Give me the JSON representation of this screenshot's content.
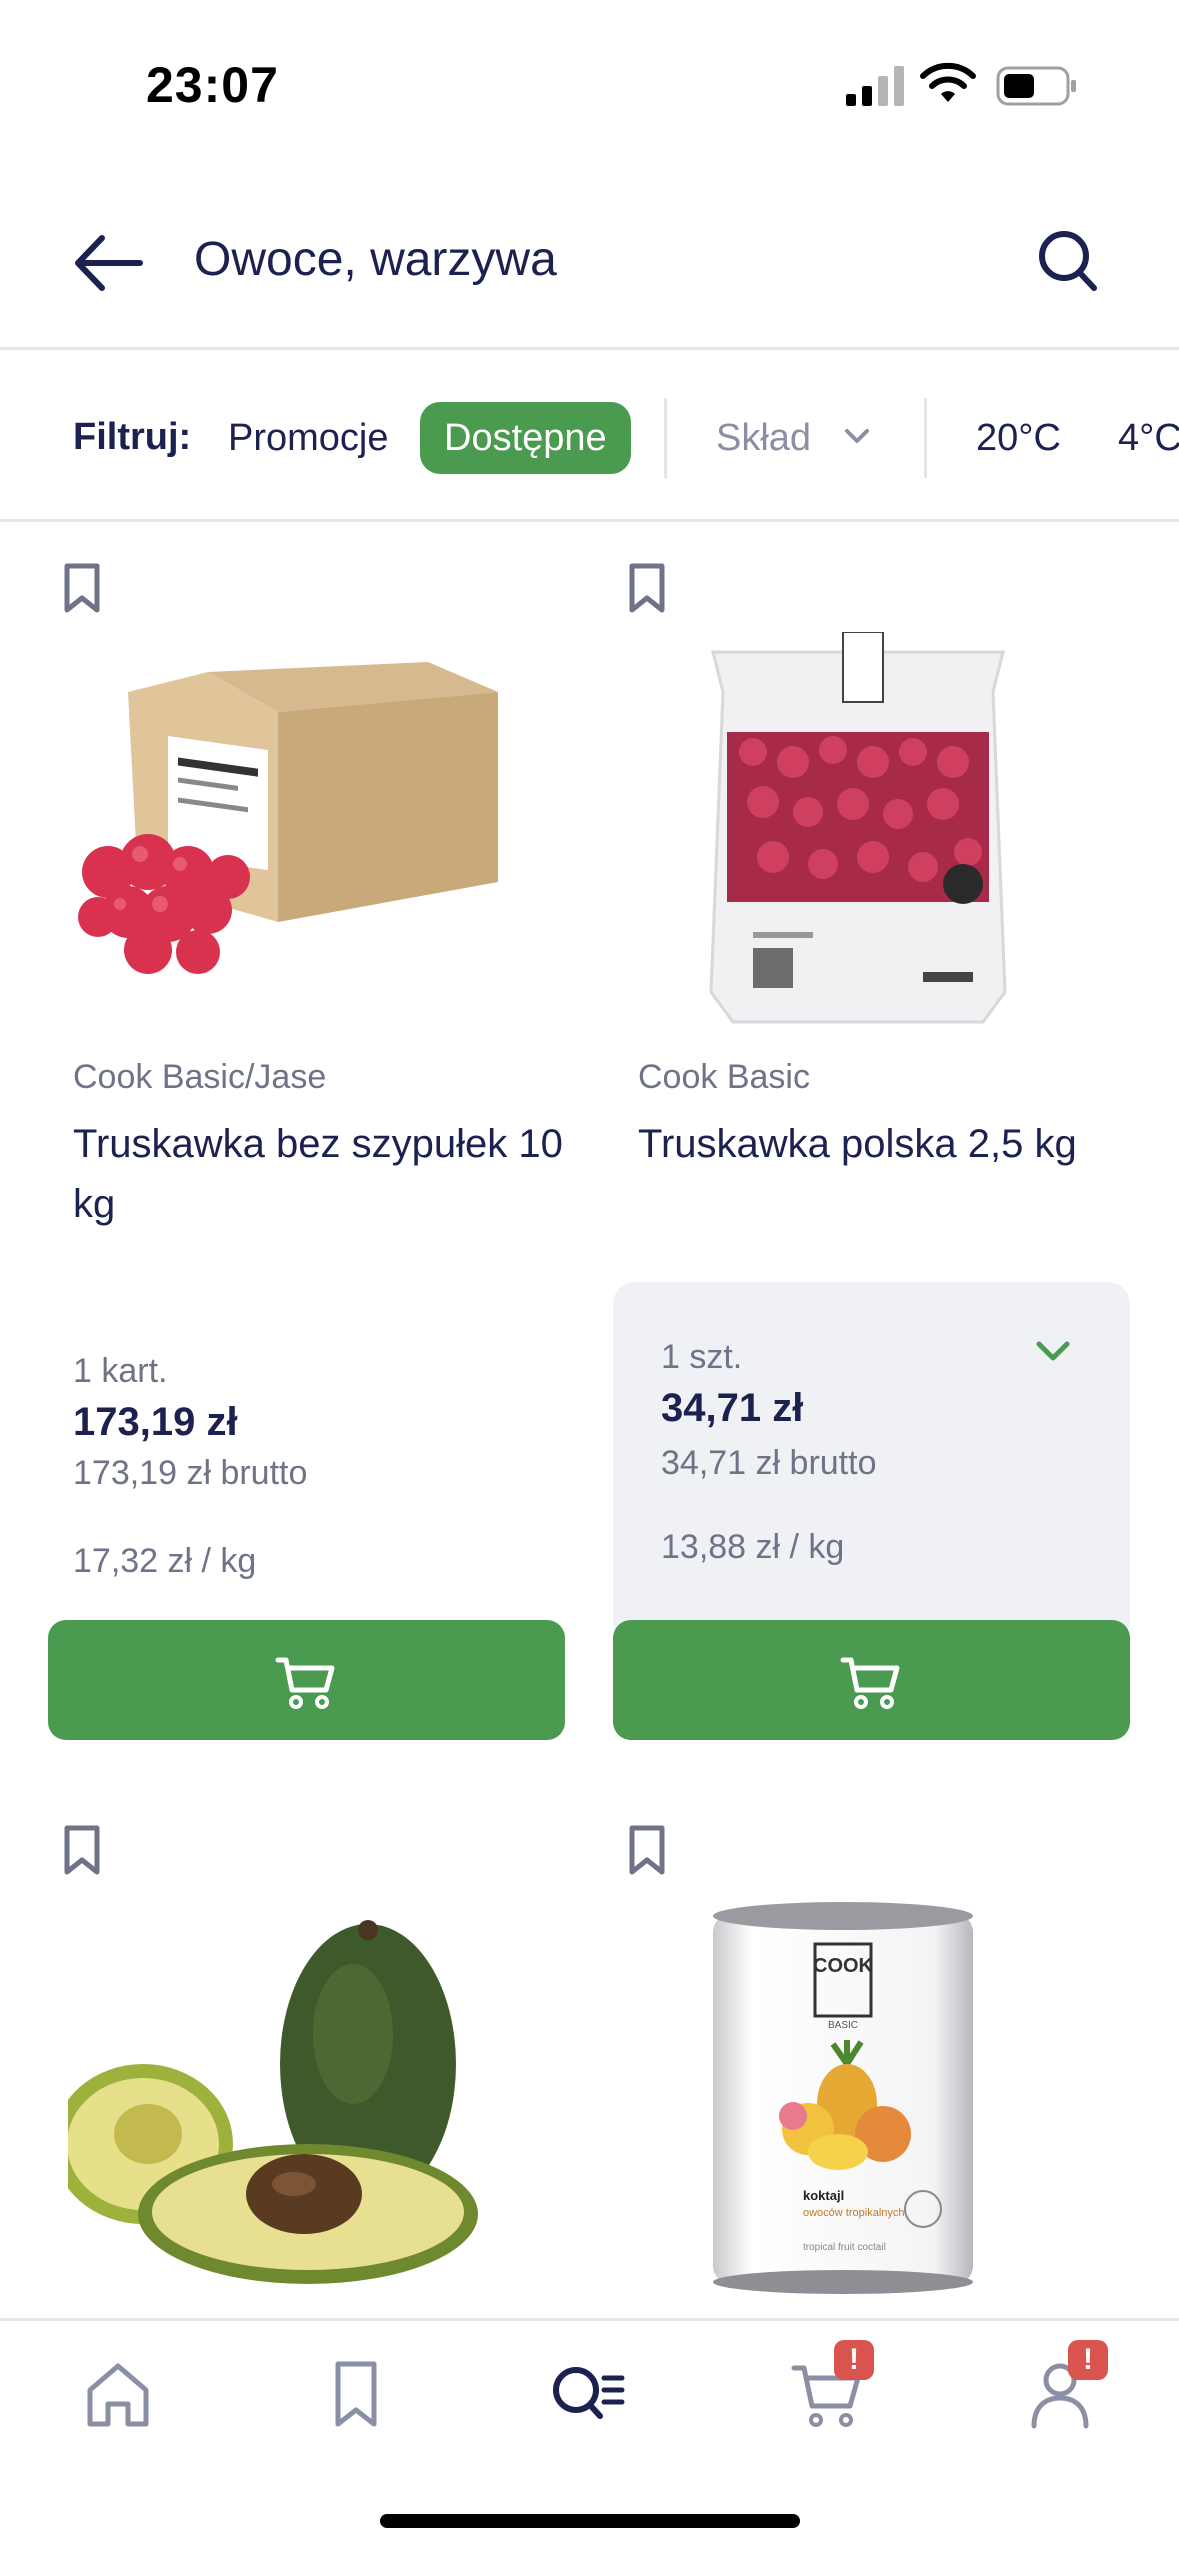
{
  "status_bar": {
    "time": "23:07"
  },
  "header": {
    "title": "Owoce, warzywa"
  },
  "filters": {
    "label": "Filtruj:",
    "chips": [
      {
        "label": "Promocje",
        "active": false
      },
      {
        "label": "Dostępne",
        "active": true
      },
      {
        "label": "Skład",
        "dropdown": true
      },
      {
        "label": "20°C"
      },
      {
        "label": "4°C"
      }
    ]
  },
  "products": [
    {
      "brand": "Cook Basic/Jase",
      "name": "Truskawka bez szypułek 10 kg",
      "unit": "1 kart.",
      "price": "173,19 zł",
      "brutto": "173,19 zł brutto",
      "per_kg": "17,32 zł / kg",
      "selected": false
    },
    {
      "brand": "Cook Basic",
      "name": "Truskawka polska 2,5 kg",
      "unit": "1 szt.",
      "price": "34,71 zł",
      "brutto": "34,71 zł brutto",
      "per_kg": "13,88 zł / kg",
      "selected": true
    },
    {
      "brand": "",
      "name": "",
      "image": "avocado"
    },
    {
      "brand": "",
      "name": "",
      "image": "tropical-fruit-can",
      "can_label": {
        "logo": "COOK",
        "sub": "BASIC",
        "title": "koktajl",
        "line2": "owoców tropikalnych",
        "line3": "tropical fruit coctail"
      }
    }
  ],
  "bottom_nav": {
    "items": [
      "home-icon",
      "bookmark-icon",
      "catalog-search-icon",
      "cart-icon",
      "account-icon"
    ],
    "active": "catalog-search-icon",
    "badges": {
      "cart": "!",
      "account": "!"
    }
  },
  "colors": {
    "primary_text": "#1c2250",
    "accent_green": "#4a9a50",
    "muted_text": "#6e7388",
    "badge_red": "#d9534f",
    "selected_bg": "#eff1f5"
  }
}
